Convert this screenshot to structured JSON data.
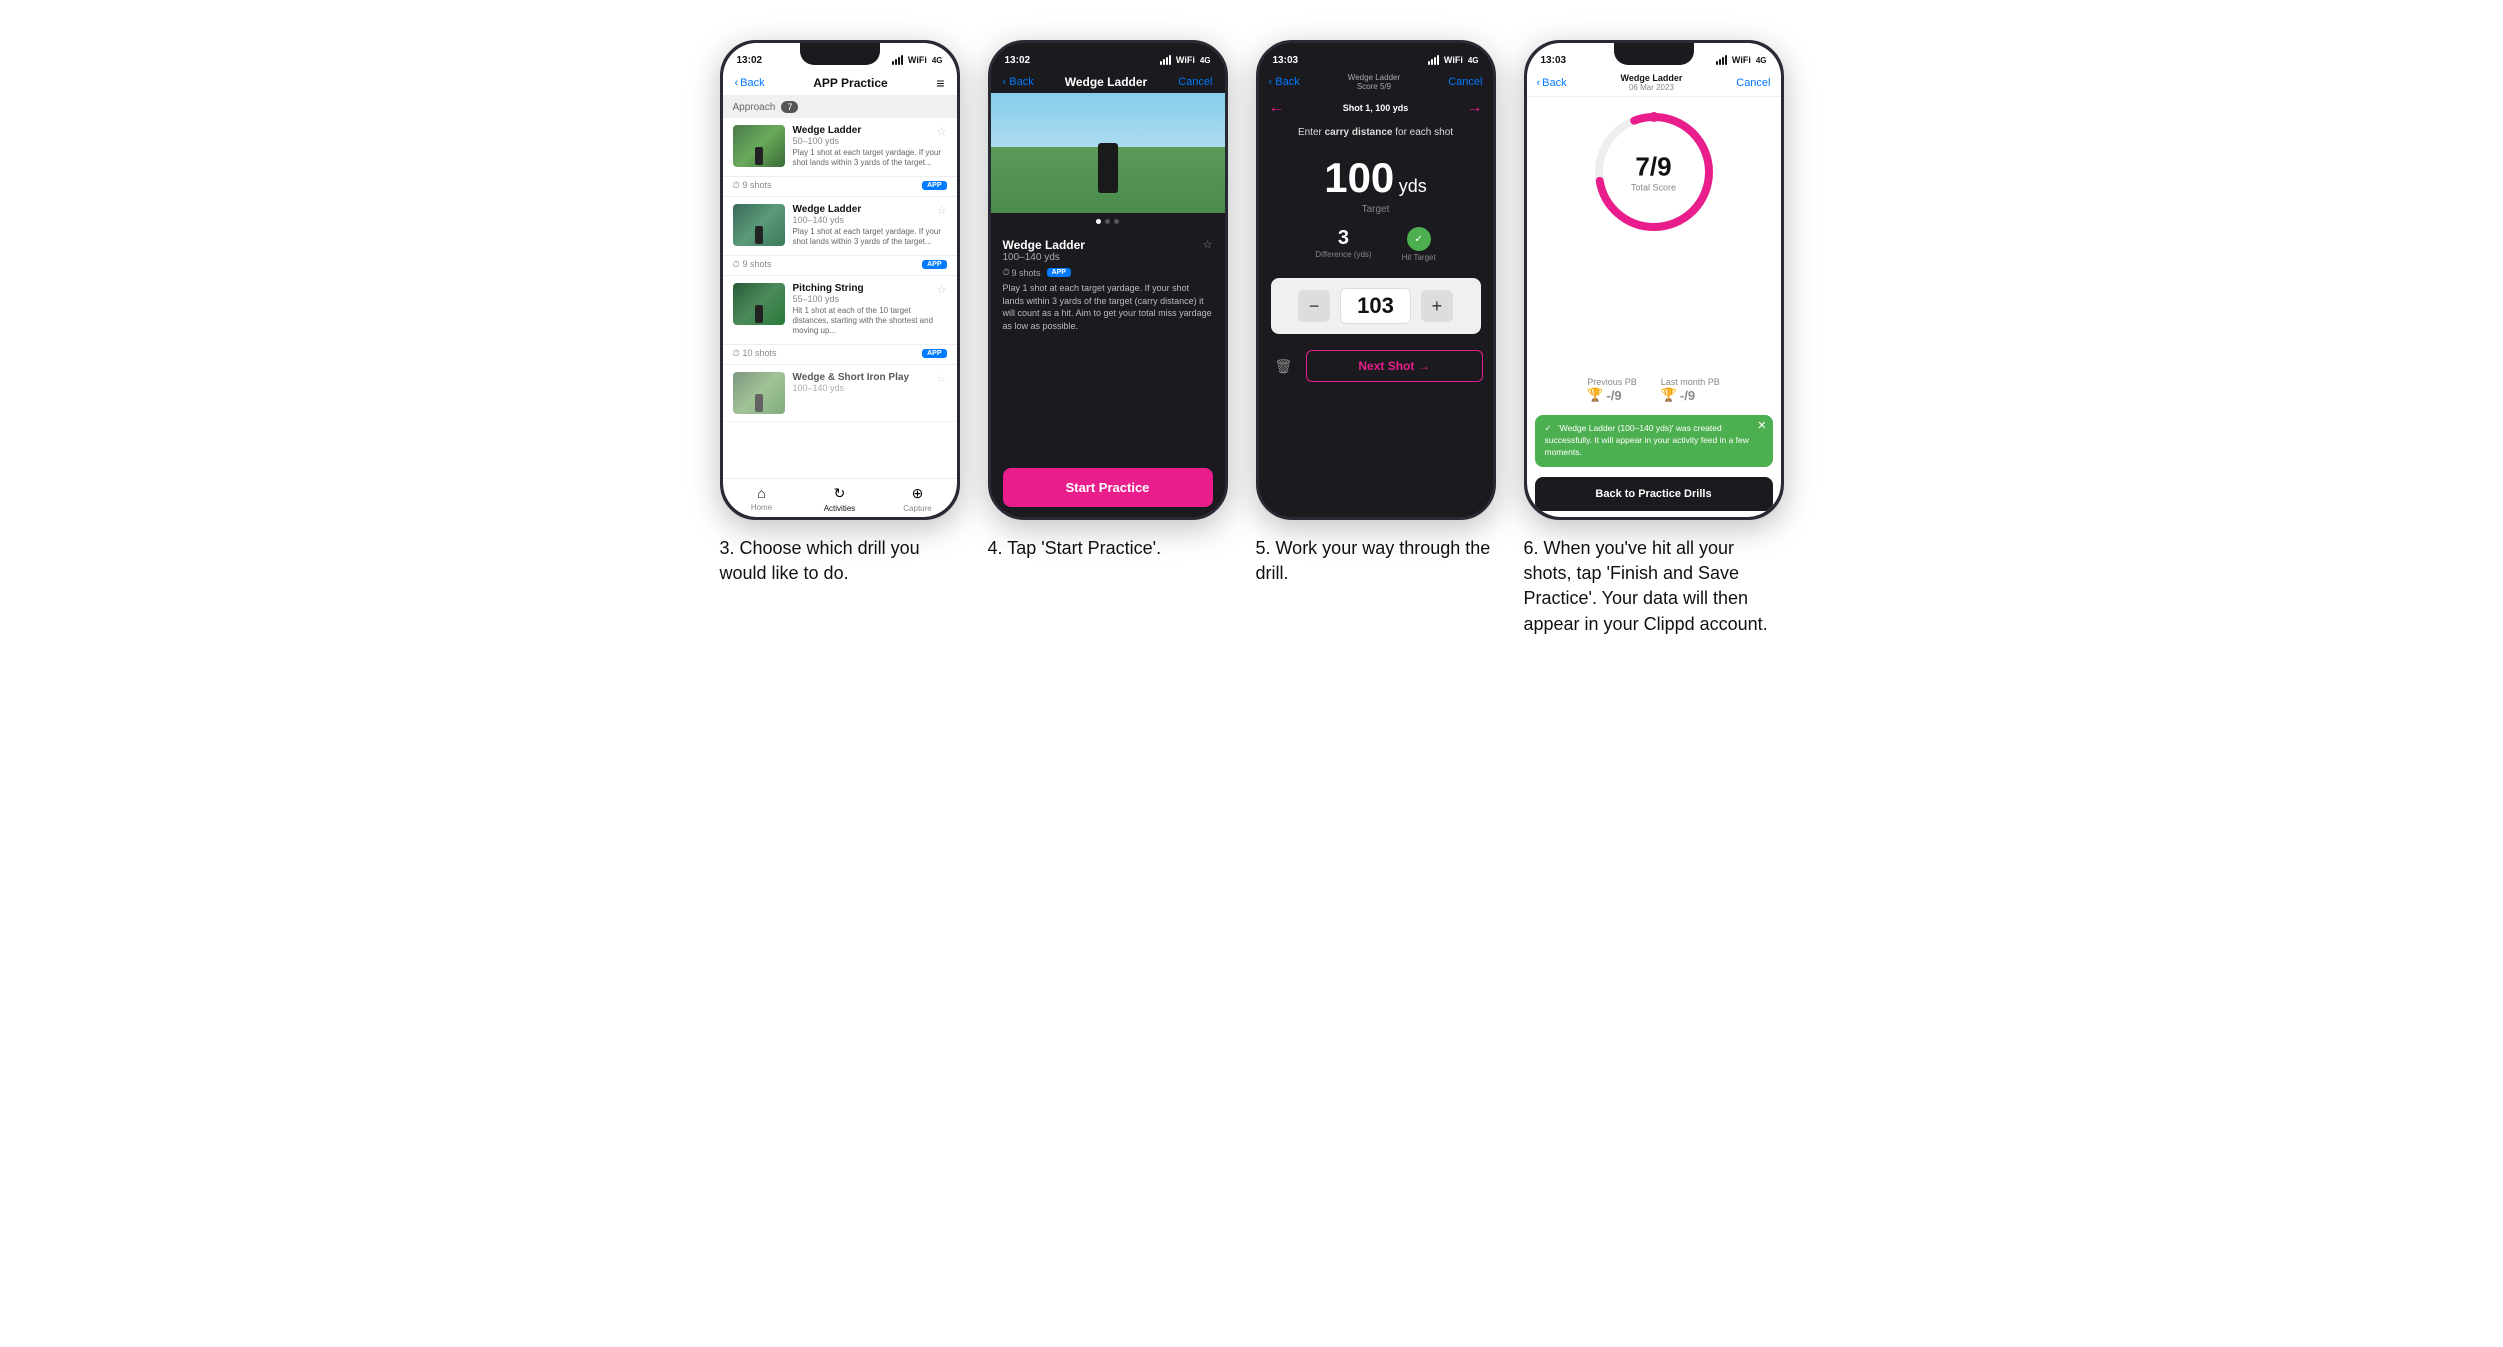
{
  "phones": [
    {
      "id": "phone1",
      "statusBar": {
        "time": "13:02",
        "theme": "light"
      },
      "nav": {
        "back": "Back",
        "title": "APP Practice",
        "menu": "≡"
      },
      "section": {
        "label": "Approach",
        "count": "7"
      },
      "drills": [
        {
          "name": "Wedge Ladder",
          "range": "50–100 yds",
          "desc": "Play 1 shot at each target yardage. If your shot lands within 3 yards of the target...",
          "shots": "9 shots",
          "hasBadge": true
        },
        {
          "name": "Wedge Ladder",
          "range": "100–140 yds",
          "desc": "Play 1 shot at each target yardage. If your shot lands within 3 yards of the target...",
          "shots": "9 shots",
          "hasBadge": true
        },
        {
          "name": "Pitching String",
          "range": "55–100 yds",
          "desc": "Hit 1 shot at each of the 10 target distances, starting with the shortest and moving up...",
          "shots": "10 shots",
          "hasBadge": true
        },
        {
          "name": "Wedge & Short Iron Play",
          "range": "100–140 yds",
          "desc": "",
          "shots": "",
          "hasBadge": false
        }
      ],
      "tabs": [
        {
          "label": "Home",
          "icon": "⌂",
          "active": false
        },
        {
          "label": "Activities",
          "icon": "↻",
          "active": true
        },
        {
          "label": "Capture",
          "icon": "+",
          "active": false
        }
      ]
    },
    {
      "id": "phone2",
      "statusBar": {
        "time": "13:02",
        "theme": "dark"
      },
      "nav": {
        "back": "Back",
        "title": "Wedge Ladder",
        "cancel": "Cancel"
      },
      "detail": {
        "name": "Wedge Ladder",
        "range": "100–140 yds",
        "shots": "9 shots",
        "badge": "APP",
        "desc": "Play 1 shot at each target yardage. If your shot lands within 3 yards of the target (carry distance) it will count as a hit. Aim to get your total miss yardage as low as possible."
      },
      "startBtn": "Start Practice"
    },
    {
      "id": "phone3",
      "statusBar": {
        "time": "13:03",
        "theme": "dark"
      },
      "nav": {
        "back": "Back",
        "subtitle": "Wedge Ladder",
        "score": "Score 5/9",
        "cancel": "Cancel"
      },
      "shotNav": {
        "shotLabel": "Shot 1, 100 yds",
        "scoreLabel": "Score 5/9"
      },
      "instruction": "Enter carry distance for each shot",
      "target": {
        "value": "100",
        "unit": "yds",
        "label": "Target"
      },
      "metrics": [
        {
          "value": "3",
          "label": "Difference (yds)"
        },
        {
          "value": "✓",
          "label": "Hit Target",
          "isCircle": true
        }
      ],
      "inputValue": "103",
      "nextShotBtn": "Next Shot"
    },
    {
      "id": "phone4",
      "statusBar": {
        "time": "13:03",
        "theme": "light"
      },
      "nav": {
        "back": "Back",
        "subtitle": "Wedge Ladder",
        "date": "06 Mar 2023",
        "cancel": "Cancel"
      },
      "score": {
        "value": "7/9",
        "label": "Total Score"
      },
      "previousPB": {
        "label": "Previous PB",
        "value": "-/9"
      },
      "lastMonthPB": {
        "label": "Last month PB",
        "value": "-/9"
      },
      "toast": "'Wedge Ladder (100–140 yds)' was created successfully. It will appear in your activity feed in a few moments.",
      "backBtn": "Back to Practice Drills"
    }
  ],
  "captions": [
    "3. Choose which drill you would like to do.",
    "4. Tap 'Start Practice'.",
    "5. Work your way through the drill.",
    "6. When you've hit all your shots, tap 'Finish and Save Practice'. Your data will then appear in your Clippd account."
  ]
}
